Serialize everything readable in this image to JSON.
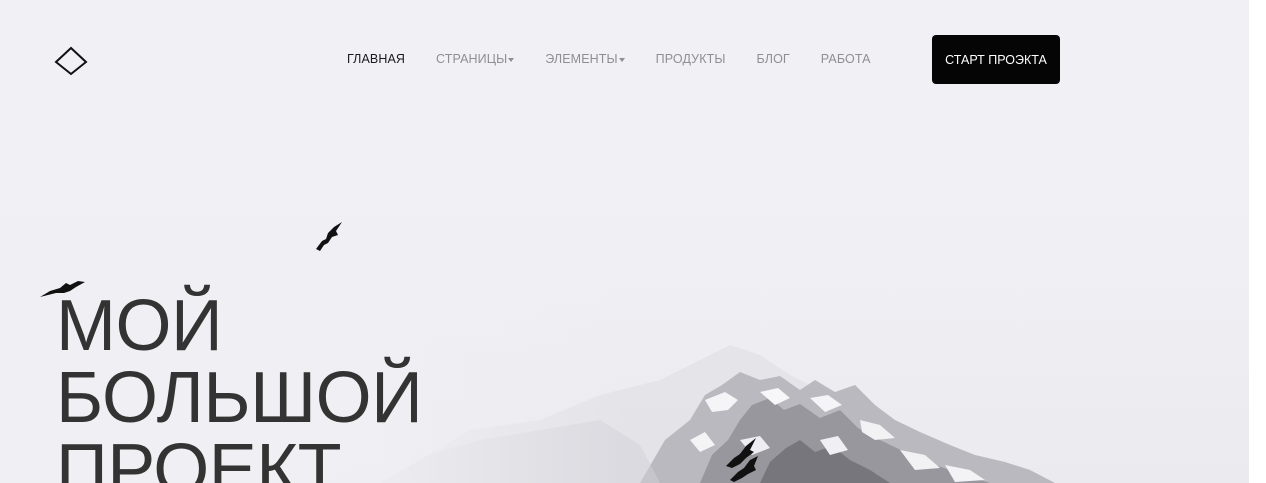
{
  "colors": {
    "sky": "#f1f1f5",
    "heading": "#333333",
    "nav_text": "#8e8e93",
    "nav_active": "#1a1a1a",
    "cta_bg": "#050505",
    "cta_text": "#ffffff"
  },
  "header": {
    "logo_icon": "diamond-outline-icon",
    "nav": {
      "home": "ГЛАВНАЯ",
      "pages": "СТРАНИЦЫ",
      "elements": "ЭЛЕМЕНТЫ",
      "products": "ПРОДУКТЫ",
      "blog": "БЛОГ",
      "work": "РАБОТА"
    },
    "cta_label": "СТАРТ ПРОЭКТА"
  },
  "hero": {
    "title_lines": [
      "МОЙ",
      "БОЛЬШОЙ",
      "ПРОЕКТ"
    ],
    "background": "misty snowy mountain with birds"
  }
}
